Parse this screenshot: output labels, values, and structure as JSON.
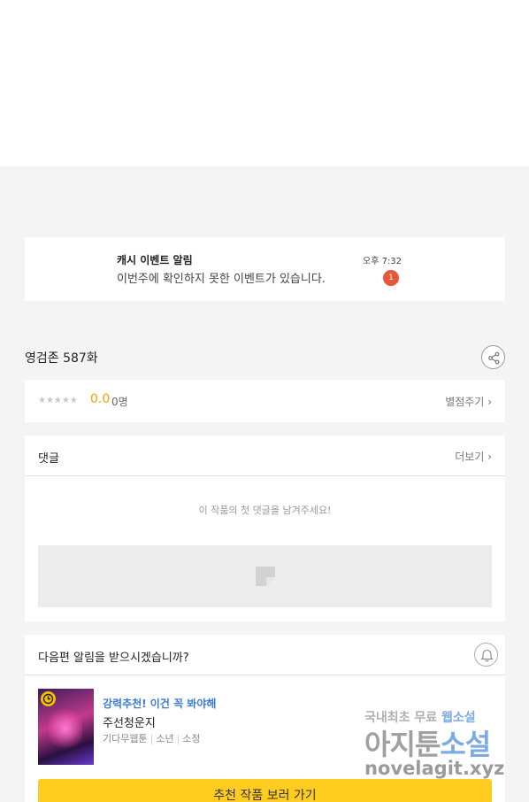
{
  "notification": {
    "title": "캐시 이벤트 알림",
    "message": "이번주에 확인하지 못한 이벤트가 있습니다.",
    "time": "오후 7:32",
    "badge": "1"
  },
  "episode": {
    "title": "영검존 587화",
    "share_icon": "share-icon"
  },
  "rating": {
    "stars_text": "★★★★★",
    "score": "0.0",
    "count": "0명",
    "rate_link": "별점주기 ›"
  },
  "comments": {
    "title": "댓글",
    "more": "더보기 ›",
    "empty_text": "이 작품의 첫 댓글을 남겨주세요!"
  },
  "next_alert": {
    "question": "다음편 알림을 받으시겠습니까?",
    "bell_icon": "bell-icon"
  },
  "recommendation": {
    "tag": "강력추천! 이건 꼭 봐야해",
    "name": "주선청운지",
    "meta": [
      "기다무웹툰",
      "소년",
      "소정"
    ],
    "button": "추천 작품 보러 가기"
  },
  "watermark": {
    "line1_prefix": "국내최초 무료 ",
    "line1_highlight": "웹소설",
    "line2_prefix": "아지툰",
    "line2_highlight": "소설",
    "line3": "novelagit.xyz"
  },
  "colors": {
    "accent_yellow": "#ffcc1f",
    "score_orange": "#f5a300",
    "badge_red": "#e8553a",
    "tag_blue": "#3a7bd5"
  }
}
